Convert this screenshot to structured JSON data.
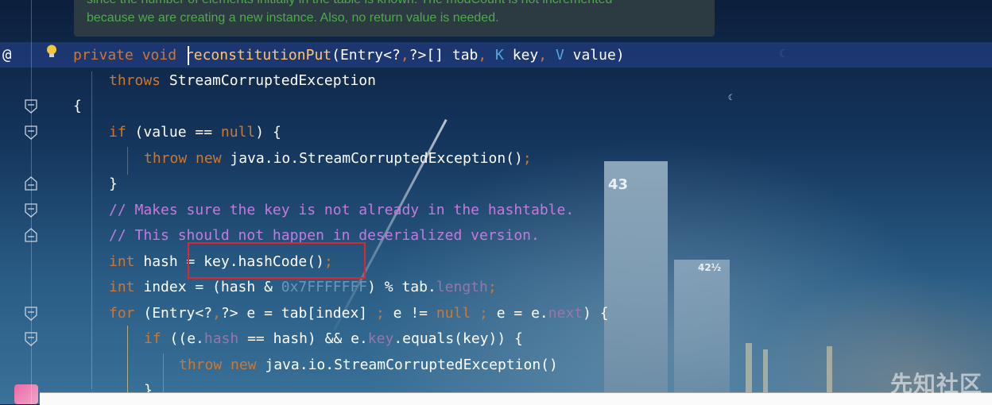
{
  "tooltip": {
    "line1": "since the number of elements initially in the table is known. The modCount is not incremented",
    "line2": "because we are creating a new instance. Also, no return value is needed."
  },
  "gutter": {
    "annotation_marker": "@"
  },
  "code": {
    "line1": {
      "kw": "private void ",
      "method": "reconstitutionPut",
      "params_a": "(Entry<?",
      "comma1": ",",
      "params_b": "?>[] tab",
      "comma2": ",",
      "K": " K",
      "key": " key",
      "comma3": ",",
      "V": " V",
      "value": " value)"
    },
    "line2": {
      "kw": "throws",
      "rest": " StreamCorruptedException"
    },
    "line3": {
      "text": "{"
    },
    "line4": {
      "kw": "if",
      "a": " (value == ",
      "kw2": "null",
      "b": ") {"
    },
    "line5": {
      "kw": "throw new",
      "a": " java.io.StreamCorruptedException()",
      "semi": ";"
    },
    "line6": {
      "text": "}"
    },
    "line7": {
      "comment": "// Makes sure the key is not already in the hashtable."
    },
    "line8": {
      "comment": "// This should not happen in deserialized version."
    },
    "line9": {
      "kw": "int",
      "a": " hash = key.hashCode()",
      "semi": ";"
    },
    "line10": {
      "kw": "int",
      "a": " index = (hash & ",
      "num": "0x7FFFFFFF",
      "b": ") % tab.",
      "field": "length",
      "semi": ";"
    },
    "line11": {
      "kw": "for",
      "a": " (Entry<?",
      "c1": ",",
      "b": "?> e = tab[index] ",
      "s1": ";",
      "c": " e != ",
      "kw2": "null",
      "s2": " ;",
      "d": " e = e.",
      "field": "next",
      "e": ") {"
    },
    "line12": {
      "kw": "if",
      "a": " ((e.",
      "f1": "hash",
      "b": " == hash) && e.",
      "f2": "key",
      "c": ".equals(key)) {"
    },
    "line13": {
      "kw": "throw new",
      "a": " java.io.StreamCorruptedException()"
    },
    "line14": {
      "text": "}"
    }
  },
  "background": {
    "tower_label_1": "43",
    "tower_label_2": "42½"
  },
  "watermark": {
    "text": "先知社区"
  },
  "colors": {
    "keyword": "#cc7832",
    "method": "#ffc66d",
    "comment": "#c679dd",
    "number": "#6897bb",
    "field": "#9876aa",
    "highlight": "#e0262a"
  }
}
